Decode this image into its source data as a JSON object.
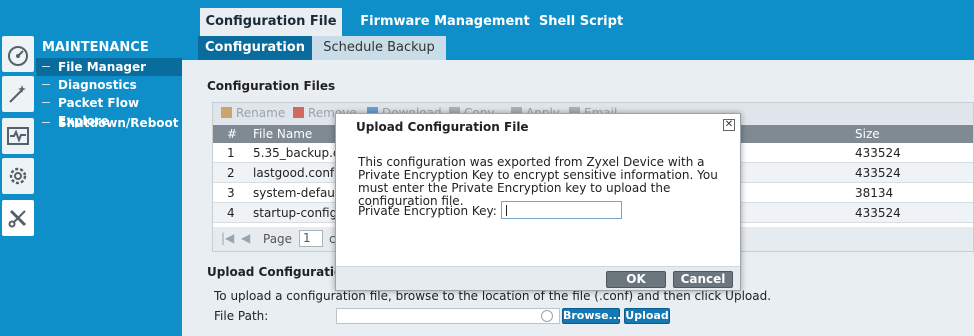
{
  "top_tabs": [
    {
      "label": "Configuration File",
      "active": true
    },
    {
      "label": "Firmware Management",
      "active": false
    },
    {
      "label": "Shell Script",
      "active": false
    }
  ],
  "sub_tabs": [
    {
      "label": "Configuration",
      "active": true
    },
    {
      "label": "Schedule Backup",
      "active": false
    }
  ],
  "sidebar": {
    "section": "MAINTENANCE",
    "items": [
      {
        "label": "File Manager",
        "active": true
      },
      {
        "label": "Diagnostics",
        "active": false
      },
      {
        "label": "Packet Flow Explore",
        "active": false
      },
      {
        "label": "Shutdown/Reboot",
        "active": false
      }
    ]
  },
  "rail_icons": [
    "dashboard-icon",
    "wizard-icon",
    "monitor-icon",
    "configuration-gear-icon",
    "maintenance-tools-icon"
  ],
  "config_files": {
    "title": "Configuration Files",
    "toolbar": [
      "Rename",
      "Remove",
      "Download",
      "Copy",
      "Apply",
      "Email"
    ],
    "columns": {
      "index": "#",
      "file_name": "File Name",
      "size": "Size"
    },
    "rows": [
      {
        "index": "1",
        "file_name": "5.35_backup.c",
        "size": "433524"
      },
      {
        "index": "2",
        "file_name": "lastgood.conf",
        "size": "433524"
      },
      {
        "index": "3",
        "file_name": "system-default",
        "size": "38134"
      },
      {
        "index": "4",
        "file_name": "startup-config.",
        "size": "433524"
      }
    ],
    "pager": {
      "page_label": "Page",
      "page_value": "1",
      "of_fragment": "c"
    }
  },
  "upload": {
    "title": "Upload Configuration Fi",
    "hint": "To upload a configuration file, browse to the location of the file (.conf) and then click Upload.",
    "file_path_label": "File Path:",
    "file_path_value": "",
    "browse_label": "Browse...",
    "upload_label": "Upload"
  },
  "modal": {
    "title": "Upload Configuration File",
    "close_glyph": "✕",
    "message": "This configuration was exported from Zyxel Device with a Private Encryption Key to encrypt sensitive information. You must enter the Private Encryption key to upload the configuration file.",
    "key_label": "Private Encryption Key:",
    "key_value": "",
    "ok_label": "OK",
    "cancel_label": "Cancel"
  },
  "colors": {
    "brand_blue": "#0e8fc9",
    "dark_blue": "#0a6c9c",
    "panel_bg": "#e9eef2"
  }
}
